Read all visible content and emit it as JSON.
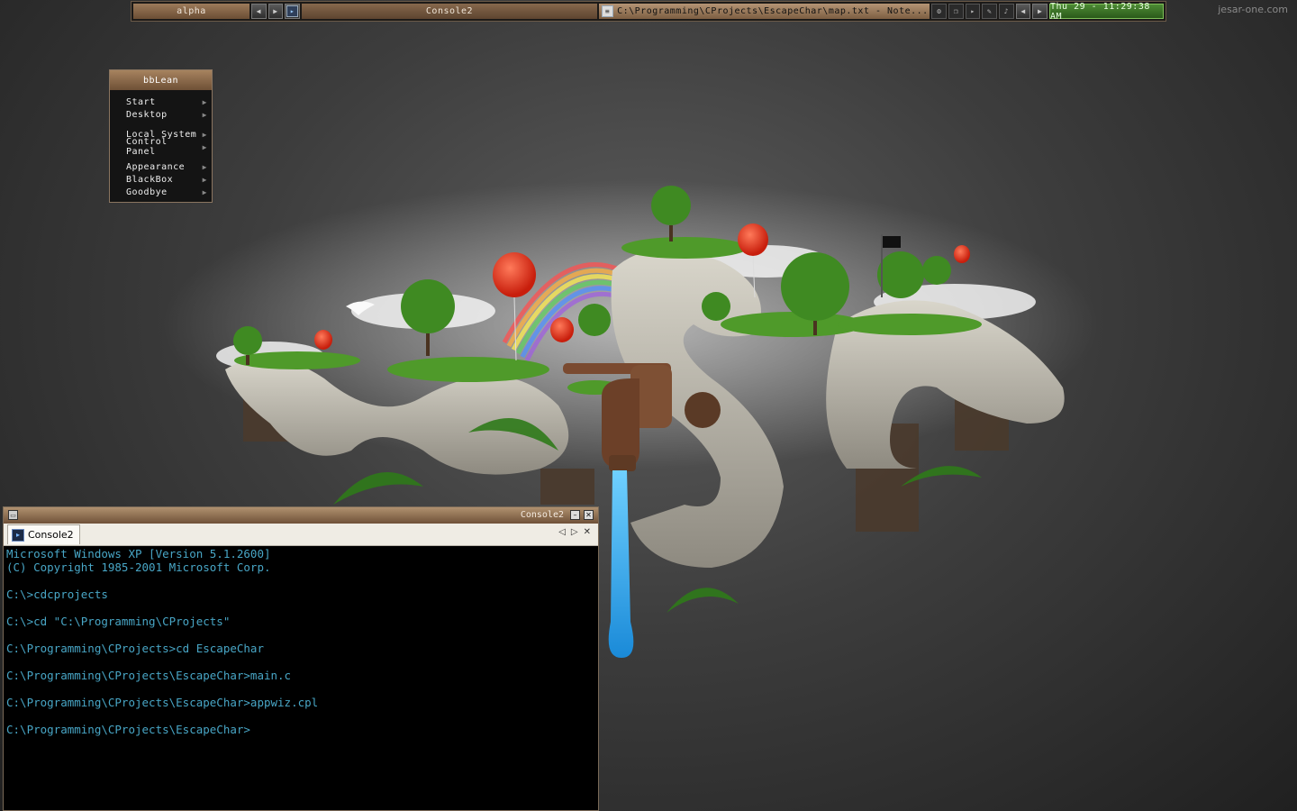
{
  "watermark": "jesar-one.com",
  "toolbar": {
    "workspace": "alpha",
    "prev_label": "◀",
    "next_label": "▶",
    "task_console_label": "Console2",
    "task_active_label": "C:\\Programming\\CProjects\\EscapeChar\\map.txt - Note...",
    "clock": "Thu 29 - 11:29:38 AM"
  },
  "menu": {
    "title": "bbLean",
    "items": [
      {
        "label": "Start"
      },
      {
        "label": "Desktop"
      },
      {
        "label": "Local System"
      },
      {
        "label": "Control Panel"
      },
      {
        "label": "Appearance"
      },
      {
        "label": "BlackBox"
      },
      {
        "label": "Goodbye"
      }
    ]
  },
  "console": {
    "title": "Console2",
    "tab_label": "Console2",
    "lines": [
      "Microsoft Windows XP [Version 5.1.2600]",
      "(C) Copyright 1985-2001 Microsoft Corp.",
      "",
      "C:\\>cdcprojects",
      "",
      "C:\\>cd \"C:\\Programming\\CProjects\"",
      "",
      "C:\\Programming\\CProjects>cd EscapeChar",
      "",
      "C:\\Programming\\CProjects\\EscapeChar>main.c",
      "",
      "C:\\Programming\\CProjects\\EscapeChar>appwiz.cpl",
      "",
      "C:\\Programming\\CProjects\\EscapeChar>"
    ]
  },
  "colors": {
    "accent_brown": "#8a6a4c",
    "clock_green": "#3c7a28",
    "console_text": "#48a6c6",
    "water_blue": "#2a9be0"
  }
}
